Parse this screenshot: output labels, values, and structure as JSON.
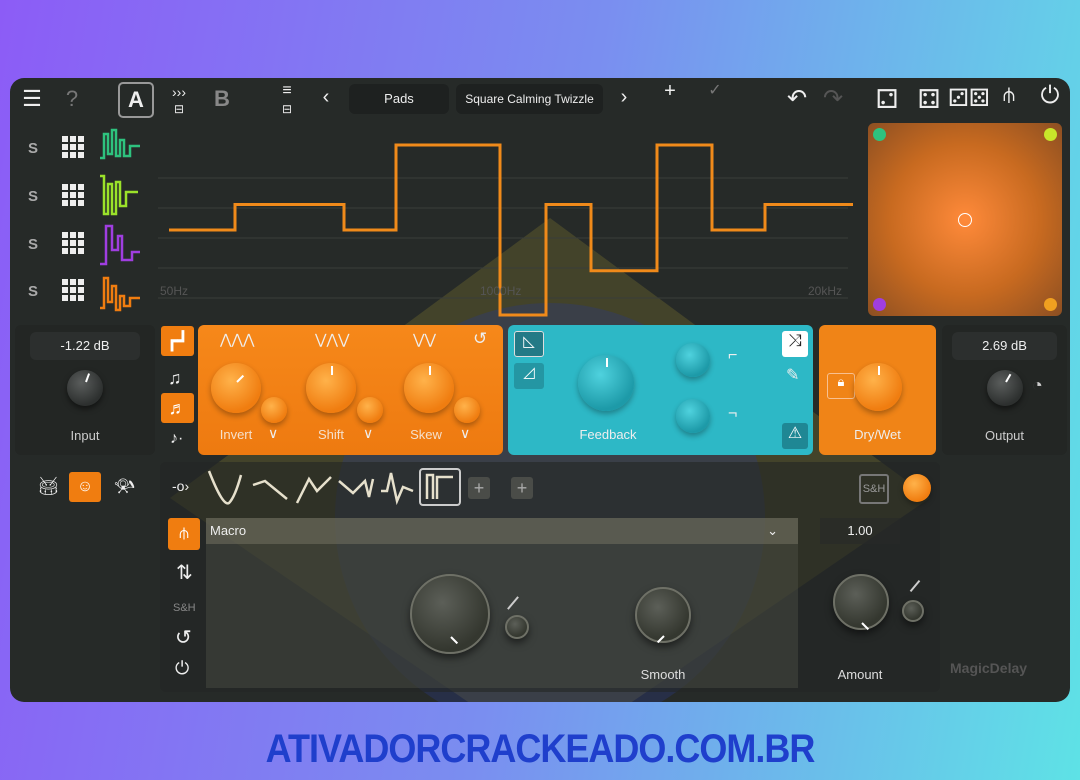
{
  "toolbar": {
    "menu_icon": "hamburger-icon",
    "help_icon": "question-icon",
    "preset_a": "A",
    "preset_b": "B",
    "category": "Pads",
    "preset_name": "Square Calming Twizzle",
    "prev": "‹",
    "next": "›"
  },
  "rows": [
    {
      "solo": "S",
      "color": "#2ec27e"
    },
    {
      "solo": "S",
      "color": "#9be22a"
    },
    {
      "solo": "S",
      "color": "#a03ee0"
    },
    {
      "solo": "S",
      "color": "#f07d10"
    }
  ],
  "graph": {
    "x_labels": [
      "50Hz",
      "1000Hz",
      "20kHz"
    ],
    "line_color": "#f08a1a",
    "levels": [
      0.4,
      0.55,
      0.4,
      0.9,
      -0.1,
      0.55,
      0.16,
      0.9,
      0.4,
      0.55
    ]
  },
  "xy_pad": {
    "corner_colors": [
      "#2ec27e",
      "#c8e62a",
      "#a03ee0",
      "#f0a020"
    ]
  },
  "input": {
    "value": "-1.22 dB",
    "label": "Input"
  },
  "output": {
    "value": "2.69 dB",
    "label": "Output"
  },
  "shape": {
    "knobs": [
      {
        "label": "Invert"
      },
      {
        "label": "Shift"
      },
      {
        "label": "Skew"
      }
    ]
  },
  "feedback": {
    "label": "Feedback"
  },
  "drywet": {
    "label": "Dry/Wet"
  },
  "mod": {
    "sh": "S&H",
    "source": "Macro",
    "amount_value": "1.00",
    "smooth_label": "Smooth",
    "amount_label": "Amount",
    "side_sh": "S&H"
  },
  "brand": "MagicDelay",
  "watermark": "ATIVADORCRACKEADO.COM.BR",
  "colors": {
    "orange": "#f07d10",
    "teal": "#2db8c6",
    "bg": "#262a28"
  }
}
